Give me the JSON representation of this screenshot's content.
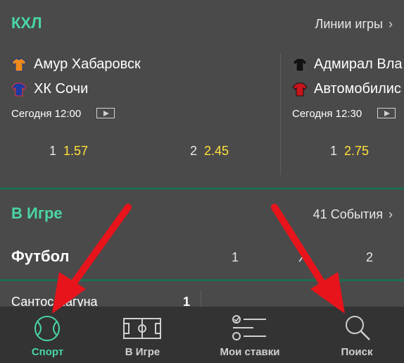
{
  "khl": {
    "title": "КХЛ",
    "lines_link": "Линии игры",
    "matches": [
      {
        "team1": "Амур Хабаровск",
        "team2": "ХК Сочи",
        "time": "Сегодня 12:00",
        "odds": [
          {
            "label": "1",
            "value": "1.57"
          },
          {
            "label": "2",
            "value": "2.45"
          }
        ]
      },
      {
        "team1": "Адмирал Вла",
        "team2": "Автомобилис",
        "time": "Сегодня 12:30",
        "odds": [
          {
            "label": "1",
            "value": "2.75"
          }
        ]
      }
    ]
  },
  "live": {
    "title": "В Игре",
    "events_link": "41 События"
  },
  "football": {
    "title": "Футбол",
    "col_labels": [
      "1",
      "X",
      "2"
    ],
    "first_row_team": "Сантос Лагуна",
    "first_row_value": "1"
  },
  "bottom_nav": {
    "items": [
      {
        "label": "Спорт",
        "icon": "tennis-ball-icon"
      },
      {
        "label": "В Игре",
        "icon": "field-icon"
      },
      {
        "label": "Мои ставки",
        "icon": "bet-list-icon"
      },
      {
        "label": "Поиск",
        "icon": "search-icon"
      }
    ]
  },
  "colors": {
    "accent": "#4ad6a3",
    "odds": "#ffe13a",
    "background": "#4a4a4a",
    "nav_background": "#333333",
    "arrow": "#e8141b"
  }
}
